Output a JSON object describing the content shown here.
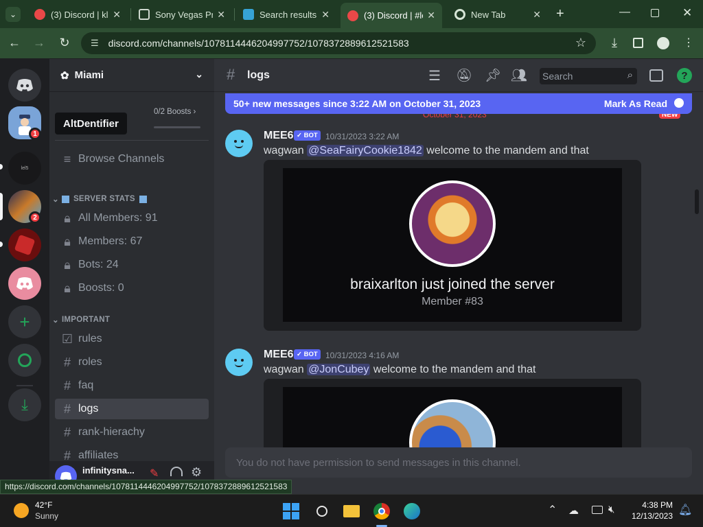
{
  "browser": {
    "tabs": [
      {
        "title": "(3) Discord | kla",
        "favicon": "discord-badge-icon",
        "color": "#e94848"
      },
      {
        "title": "Sony Vegas Pro",
        "favicon": "museum-icon",
        "color": "#cfd8cf"
      },
      {
        "title": "Search results f",
        "favicon": "search-results-icon",
        "color": "#36a3d6"
      },
      {
        "title": "(3) Discord | #lo",
        "favicon": "discord-badge-icon",
        "color": "#e94848"
      },
      {
        "title": "New Tab",
        "favicon": "chrome-icon",
        "color": "#d6e5d6"
      }
    ],
    "url": "discord.com/channels/1078114446204997752/1078372889612521583",
    "status_url": "https://discord.com/channels/1078114446204997752/1078372889612521583"
  },
  "discord": {
    "server_name": "Miami",
    "tooltip": "AltDentifier",
    "boosts": "0/2 Boosts",
    "guild_badges": [
      "1",
      "2"
    ],
    "browse_channels": "Browse Channels",
    "categories": {
      "server_stats": "SERVER STATS",
      "important": "IMPORTANT"
    },
    "stat_channels": [
      "All Members: 91",
      "Members: 67",
      "Bots: 24",
      "Boosts: 0"
    ],
    "important_channels": [
      "rules",
      "roles",
      "faq",
      "logs",
      "rank-hierachy",
      "affiliates"
    ],
    "current_channel": "logs",
    "search_placeholder": "Search",
    "new_messages_banner": "50+ new messages since 3:22 AM on October 31, 2023",
    "mark_as_read": "Mark As Read",
    "date_divider": "October 31, 2023",
    "new_badge": "NEW",
    "messages": [
      {
        "author": "MEE6",
        "bot_tag": "BOT",
        "time": "10/31/2023 3:22 AM",
        "text_prefix": "wagwan ",
        "mention": "@SeaFairyCookie1842",
        "text_suffix": " welcome to the mandem and that",
        "embed_title": "braixarlton just joined the server",
        "embed_sub": "Member #83"
      },
      {
        "author": "MEE6",
        "bot_tag": "BOT",
        "time": "10/31/2023 4:16 AM",
        "text_prefix": "wagwan ",
        "mention": "@JonCubey",
        "text_suffix": " welcome to the mandem and that"
      }
    ],
    "no_permission": "You do not have permission to send messages in this channel.",
    "username": "infinitysna...",
    "brand_color": "#5865f2"
  },
  "taskbar": {
    "temp": "42°F",
    "weather": "Sunny",
    "time": "4:38 PM",
    "date": "12/13/2023"
  }
}
